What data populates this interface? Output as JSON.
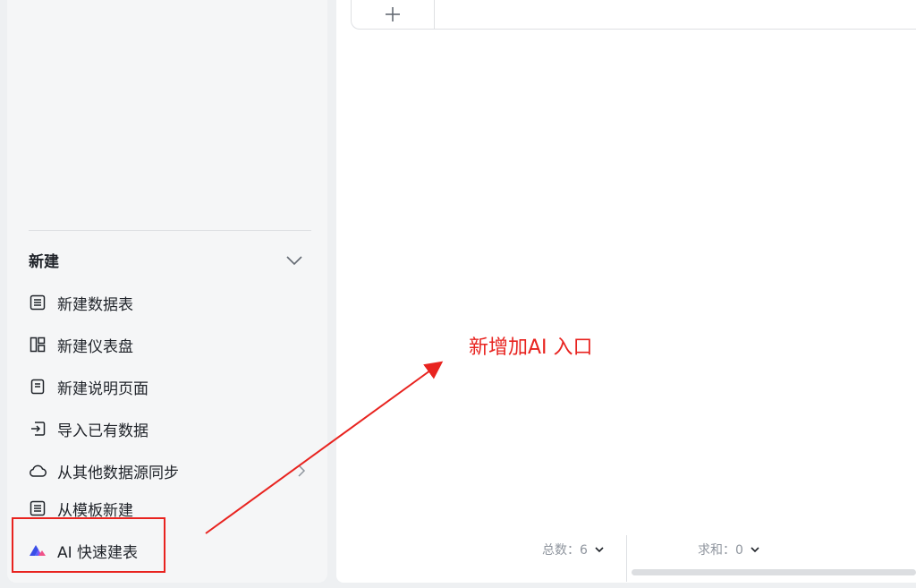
{
  "sidebar": {
    "section_title": "新建",
    "items": [
      {
        "label": "新建数据表",
        "icon": "table-icon"
      },
      {
        "label": "新建仪表盘",
        "icon": "dashboard-icon"
      },
      {
        "label": "新建说明页面",
        "icon": "document-icon"
      },
      {
        "label": "导入已有数据",
        "icon": "import-icon"
      },
      {
        "label": "从其他数据源同步",
        "icon": "cloud-icon"
      },
      {
        "label": "从模板新建",
        "icon": "template-icon"
      },
      {
        "label": "AI 快速建表",
        "icon": "ai-logo-icon"
      }
    ]
  },
  "main": {
    "add_tab_icon": "plus-icon",
    "footer": {
      "count_label": "总数：6",
      "sum_label": "求和：0"
    }
  },
  "annotation": {
    "text": "新增加AI 入口",
    "color": "#e8231f"
  }
}
